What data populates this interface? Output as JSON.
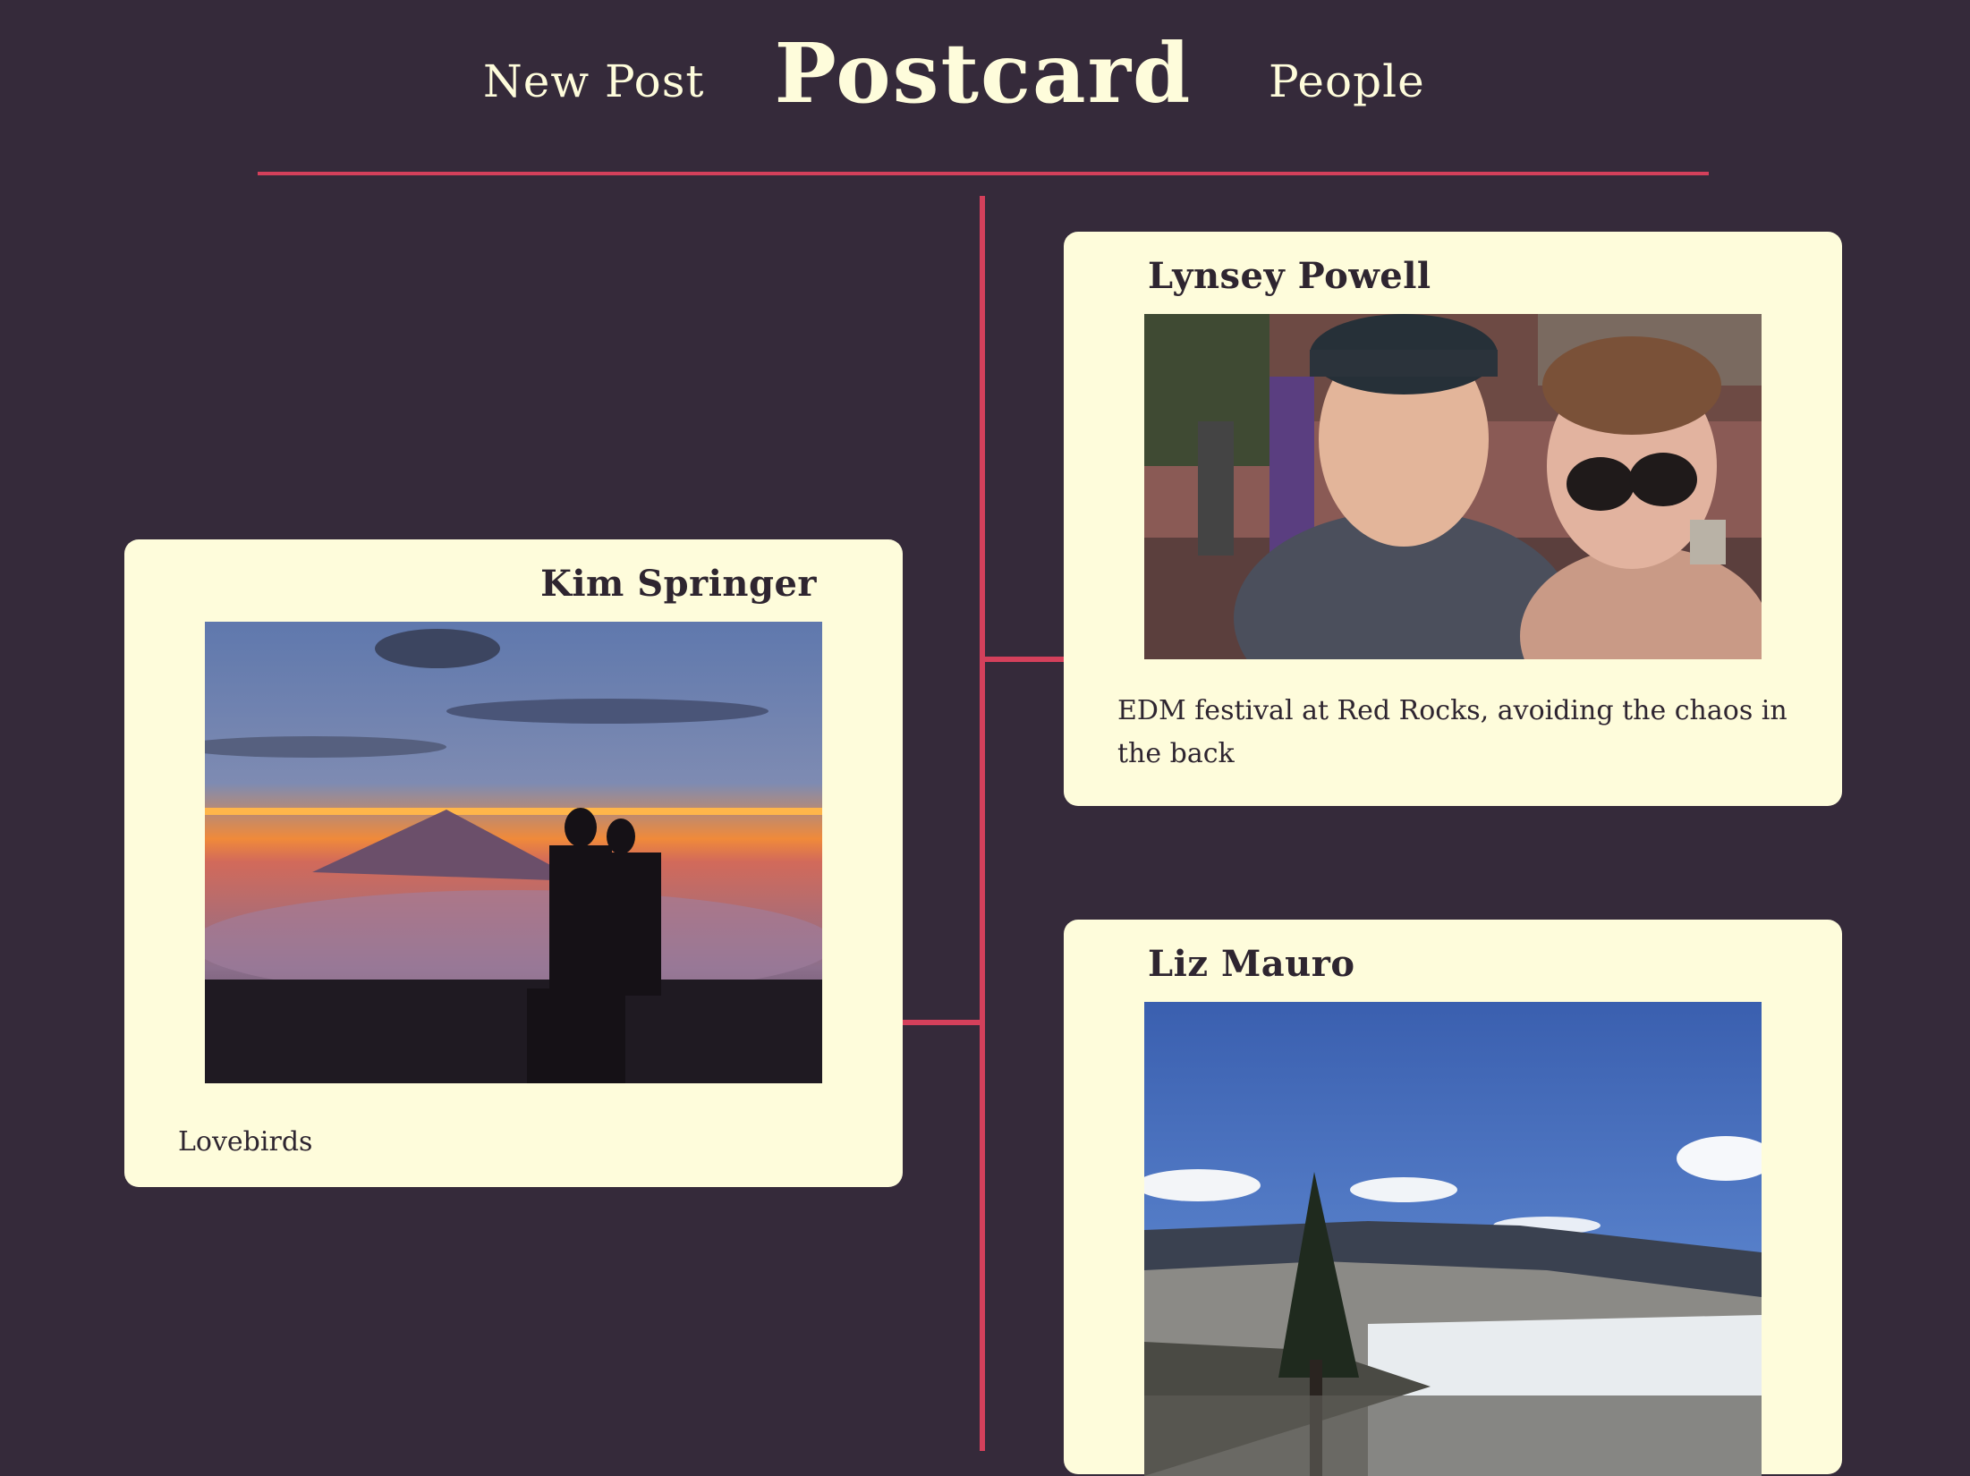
{
  "nav": {
    "new_post": "New Post",
    "brand": "Postcard",
    "people": "People"
  },
  "colors": {
    "background": "#352a3a",
    "accent": "#d4405b",
    "card": "#fefcdb",
    "text_dark": "#2e2530",
    "text_light": "#fefcdb"
  },
  "posts": [
    {
      "author": "Lynsey Powell",
      "caption": "EDM festival at Red Rocks, avoiding the chaos in the back",
      "photo": "selfie-at-red-rocks-photo"
    },
    {
      "author": "Kim Springer",
      "caption": "Lovebirds",
      "photo": "sunset-silhouette-photo"
    },
    {
      "author": "Liz Mauro",
      "caption": "",
      "photo": "mountain-valley-photo"
    }
  ]
}
